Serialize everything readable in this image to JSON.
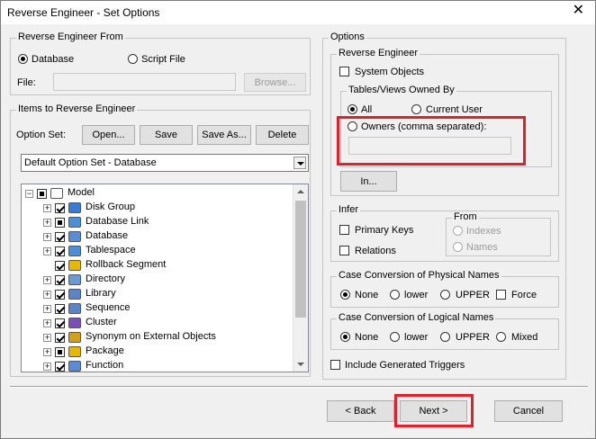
{
  "window": {
    "title": "Reverse Engineer - Set Options",
    "close_glyph": "✕"
  },
  "reverse_from": {
    "title": "Reverse Engineer From",
    "database_label": "Database",
    "script_label": "Script File",
    "file_label": "File:",
    "file_value": "",
    "browse_label": "Browse..."
  },
  "items": {
    "title": "Items to Reverse Engineer",
    "option_set_label": "Option Set:",
    "open_label": "Open...",
    "save_label": "Save",
    "save_as_label": "Save As...",
    "delete_label": "Delete",
    "option_set_value": "Default Option Set - Database",
    "tree": [
      {
        "label": "Model",
        "icon": "model-icon",
        "check": "filled"
      },
      {
        "label": "Disk Group",
        "icon": "disk-group-icon",
        "check": "checked"
      },
      {
        "label": "Database Link",
        "icon": "database-link-icon",
        "check": "filled"
      },
      {
        "label": "Database",
        "icon": "database-icon",
        "check": "checked"
      },
      {
        "label": "Tablespace",
        "icon": "tablespace-icon",
        "check": "checked"
      },
      {
        "label": "Rollback Segment",
        "icon": "rollback-segment-icon",
        "check": "checked"
      },
      {
        "label": "Directory",
        "icon": "directory-icon",
        "check": "checked"
      },
      {
        "label": "Library",
        "icon": "library-icon",
        "check": "checked"
      },
      {
        "label": "Sequence",
        "icon": "sequence-icon",
        "check": "checked"
      },
      {
        "label": "Cluster",
        "icon": "cluster-icon",
        "check": "checked"
      },
      {
        "label": "Synonym on External Objects",
        "icon": "synonym-icon",
        "check": "checked"
      },
      {
        "label": "Package",
        "icon": "package-icon",
        "check": "filled"
      },
      {
        "label": "Function",
        "icon": "function-icon",
        "check": "checked"
      }
    ]
  },
  "options": {
    "title": "Options",
    "reverse_engineer": {
      "title": "Reverse Engineer",
      "system_objects_label": "System Objects",
      "owned_by": {
        "title": "Tables/Views Owned By",
        "all_label": "All",
        "current_user_label": "Current User",
        "owners_label": "Owners (comma separated):",
        "owners_value": ""
      },
      "in_label": "In..."
    },
    "infer": {
      "title": "Infer",
      "primary_keys_label": "Primary Keys",
      "relations_label": "Relations",
      "from_title": "From",
      "indexes_label": "Indexes",
      "names_label": "Names"
    },
    "case_physical": {
      "title": "Case Conversion of Physical Names",
      "none_label": "None",
      "lower_label": "lower",
      "upper_label": "UPPER",
      "force_label": "Force"
    },
    "case_logical": {
      "title": "Case Conversion of Logical Names",
      "none_label": "None",
      "lower_label": "lower",
      "upper_label": "UPPER",
      "mixed_label": "Mixed"
    },
    "include_triggers_label": "Include Generated Triggers"
  },
  "footer": {
    "back_label": "< Back",
    "next_label": "Next >",
    "cancel_label": "Cancel"
  },
  "colors": {
    "highlight_red": "#e0202a"
  }
}
